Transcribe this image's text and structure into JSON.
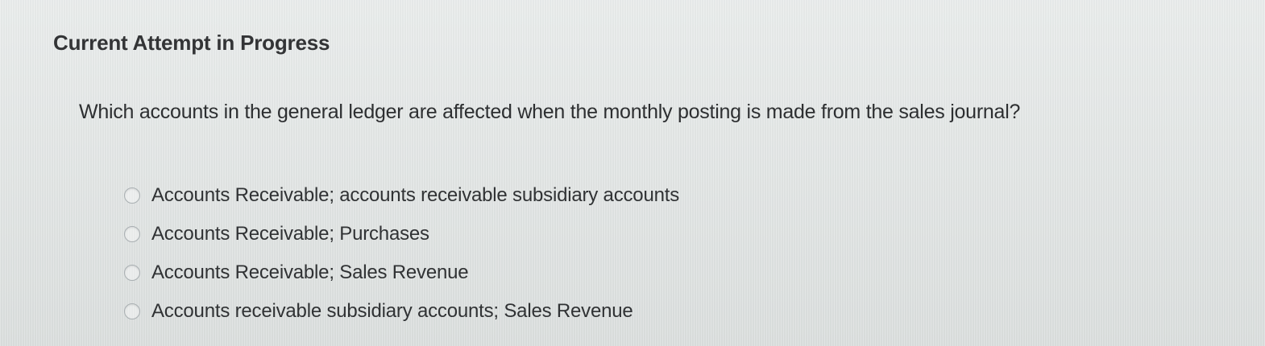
{
  "attempt": {
    "title": "Current Attempt in Progress"
  },
  "question": {
    "text": "Which accounts in the general ledger are affected when the monthly posting is made from the sales journal?",
    "options": [
      {
        "label": "Accounts Receivable; accounts receivable subsidiary accounts",
        "selected": false,
        "icon": "radio-empty"
      },
      {
        "label": "Accounts Receivable; Purchases",
        "selected": false,
        "icon": "radio-empty"
      },
      {
        "label": "Accounts Receivable; Sales Revenue",
        "selected": false,
        "icon": "radio-empty"
      },
      {
        "label": "Accounts receivable subsidiary accounts; Sales Revenue",
        "selected": false,
        "icon": "radio-empty"
      }
    ]
  },
  "colors": {
    "background": "#e3e7e6",
    "text": "#2f3133",
    "radio_border": "#a9afb2"
  }
}
